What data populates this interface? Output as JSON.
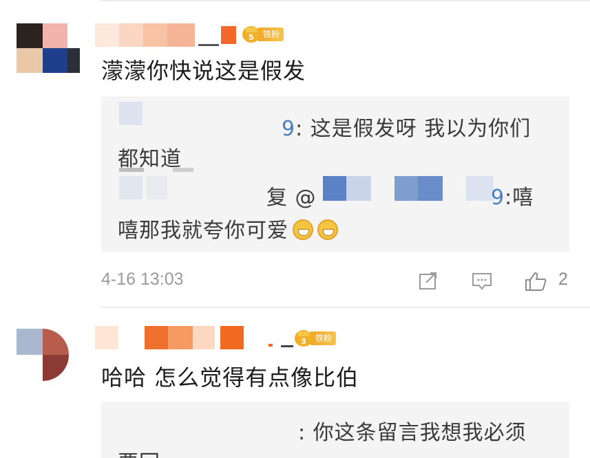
{
  "comments": [
    {
      "badge": {
        "level": "5",
        "label": "铁粉"
      },
      "text": "濛濛你快说这是假发",
      "reply": {
        "line1_name_suffix": "9",
        "line1_text": ": 这是假发呀 我以为你们",
        "line2_text": "都知道",
        "line3_reply": "复 @",
        "line3_name_suffix": "9",
        "line3_text": ":嘻",
        "line4_text": "嘻那我就夸你可爱"
      },
      "meta": {
        "timestamp": "4-16 13:03",
        "likes": "2"
      }
    },
    {
      "badge": {
        "level": "3",
        "label": "铁粉"
      },
      "text": "哈哈  怎么觉得有点像比伯",
      "reply": {
        "line1_text": ": 你这条留言我想我必须",
        "line2_text": "要回"
      }
    }
  ],
  "icons": {
    "share": "share-icon",
    "comment": "comment-icon",
    "like": "thumbs-up-icon"
  },
  "colors": {
    "reply_name": "#4a7fc4",
    "badge": "#f1a727",
    "reply_bg": "#f4f4f4"
  }
}
